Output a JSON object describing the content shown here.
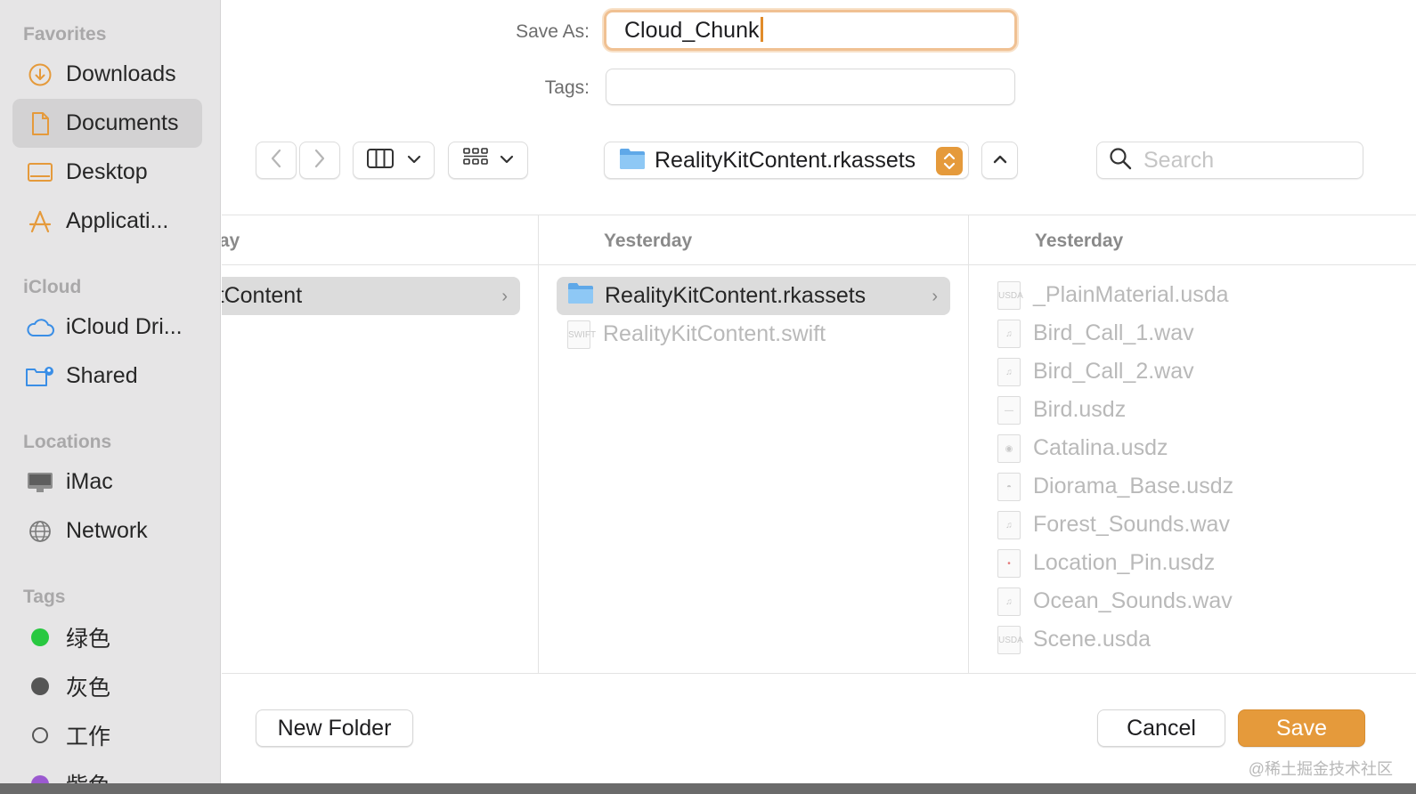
{
  "sidebar": {
    "sections": [
      {
        "title": "Favorites"
      },
      {
        "title": "iCloud"
      },
      {
        "title": "Locations"
      },
      {
        "title": "Tags"
      }
    ],
    "favorites": [
      {
        "label": "Downloads",
        "icon": "download-circle-icon"
      },
      {
        "label": "Documents",
        "icon": "document-icon",
        "selected": true
      },
      {
        "label": "Desktop",
        "icon": "desktop-icon"
      },
      {
        "label": "Applicati...",
        "icon": "applications-icon"
      }
    ],
    "icloud": [
      {
        "label": "iCloud Dri...",
        "icon": "cloud-icon"
      },
      {
        "label": "Shared",
        "icon": "shared-folder-icon"
      }
    ],
    "locations": [
      {
        "label": "iMac",
        "icon": "imac-icon"
      },
      {
        "label": "Network",
        "icon": "network-globe-icon"
      }
    ],
    "tags": [
      {
        "label": "绿色",
        "color": "#28c840"
      },
      {
        "label": "灰色",
        "color": "#555555"
      },
      {
        "label": "工作",
        "color": "none"
      },
      {
        "label": "紫色",
        "color": "#9b59d0"
      }
    ]
  },
  "form": {
    "save_as_label": "Save As:",
    "save_as_value": "Cloud_Chunk",
    "tags_label": "Tags:",
    "tags_value": ""
  },
  "toolbar": {
    "path_popup_label": "RealityKitContent.rkassets",
    "search_placeholder": "Search"
  },
  "browser": {
    "columns": [
      {
        "header": "Yesterday",
        "rows": [
          {
            "name": "RealityKitContent",
            "selected": true,
            "has_children": true
          }
        ]
      },
      {
        "header": "Yesterday",
        "rows": [
          {
            "name": "RealityKitContent.rkassets",
            "selected": true,
            "has_children": true,
            "kind": "folder"
          },
          {
            "name": "RealityKitContent.swift",
            "dim": true,
            "kind": "swift"
          }
        ]
      },
      {
        "header": "Yesterday",
        "rows": [
          {
            "name": "_PlainMaterial.usda",
            "kind": "usda"
          },
          {
            "name": "Bird_Call_1.wav",
            "kind": "audio"
          },
          {
            "name": "Bird_Call_2.wav",
            "kind": "audio"
          },
          {
            "name": "Bird.usdz",
            "kind": "usdz"
          },
          {
            "name": "Catalina.usdz",
            "kind": "usdz"
          },
          {
            "name": "Diorama_Base.usdz",
            "kind": "usdz"
          },
          {
            "name": "Forest_Sounds.wav",
            "kind": "audio"
          },
          {
            "name": "Location_Pin.usdz",
            "kind": "usdz"
          },
          {
            "name": "Ocean_Sounds.wav",
            "kind": "audio"
          },
          {
            "name": "Scene.usda",
            "kind": "usda"
          }
        ]
      }
    ]
  },
  "buttons": {
    "new_folder": "New Folder",
    "cancel": "Cancel",
    "save": "Save"
  },
  "watermark": "@稀土掘金技术社区",
  "colors": {
    "accent": "#e59a3b",
    "sidebar_bg": "#e6e5e6",
    "selection": "#dcdcdc"
  }
}
